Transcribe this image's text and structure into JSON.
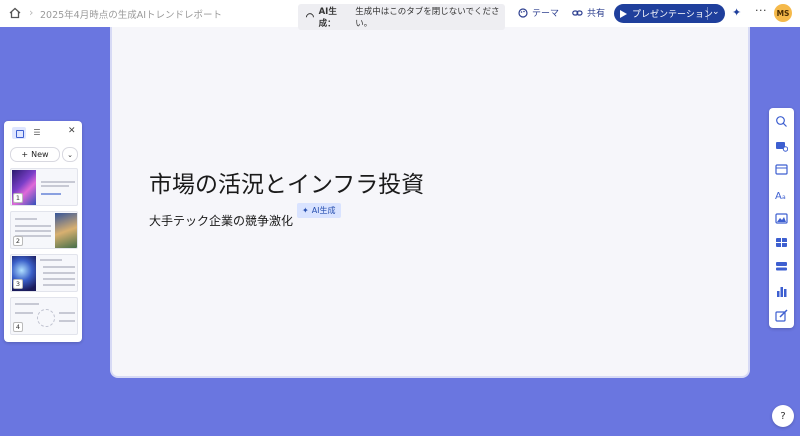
{
  "header": {
    "breadcrumb_title": "2025年4月時点の生成AIトレンドレポート",
    "toast_label": "AI生成：",
    "toast_message": "生成中はこのタブを閉じないでください。",
    "theme_label": "テーマ",
    "share_label": "共有",
    "present_label": "プレゼンテーション",
    "avatar_initials": "MS"
  },
  "slide": {
    "title": "市場の活況とインフラ投資",
    "subtitle": "大手テック企業の競争激化",
    "ai_badge_label": "AI生成"
  },
  "panel": {
    "new_label": "New",
    "thumbnails": [
      {
        "number": "1"
      },
      {
        "number": "2"
      },
      {
        "number": "3"
      },
      {
        "number": "4"
      }
    ]
  },
  "help_label": "?",
  "colors": {
    "background": "#6a76e0",
    "primary": "#1f3f9c",
    "avatar": "#f5b94a",
    "badge": "#d9e3ff"
  }
}
